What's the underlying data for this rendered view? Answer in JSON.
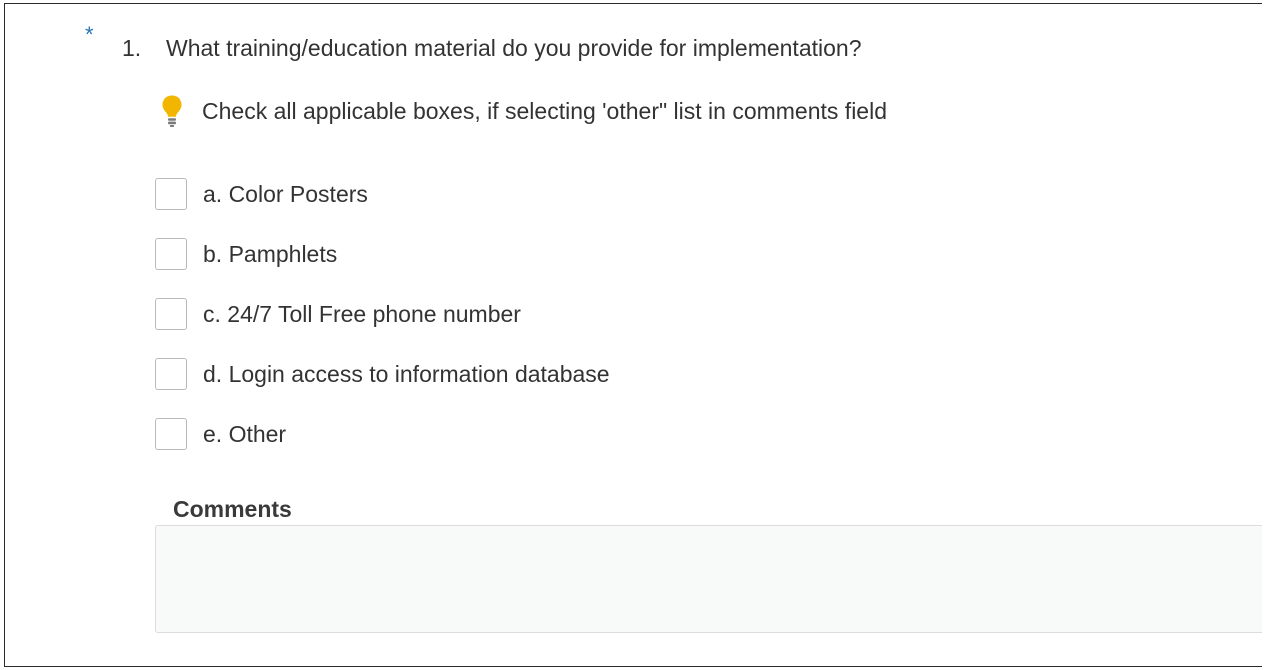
{
  "question": {
    "required_marker": "*",
    "number": "1.",
    "text": "What training/education material do you provide for implementation?",
    "hint": "Check all applicable boxes, if selecting 'other\" list in comments field",
    "hint_icon": "lightbulb-icon",
    "accent_color": "#2a75b5",
    "hint_icon_color": "#f2b600",
    "options": [
      {
        "label": "a. Color Posters",
        "checked": false
      },
      {
        "label": "b. Pamphlets",
        "checked": false
      },
      {
        "label": "c. 24/7 Toll Free phone number",
        "checked": false
      },
      {
        "label": "d. Login access to information database",
        "checked": false
      },
      {
        "label": "e. Other",
        "checked": false
      }
    ]
  },
  "comments": {
    "label": "Comments",
    "value": "",
    "placeholder": ""
  }
}
